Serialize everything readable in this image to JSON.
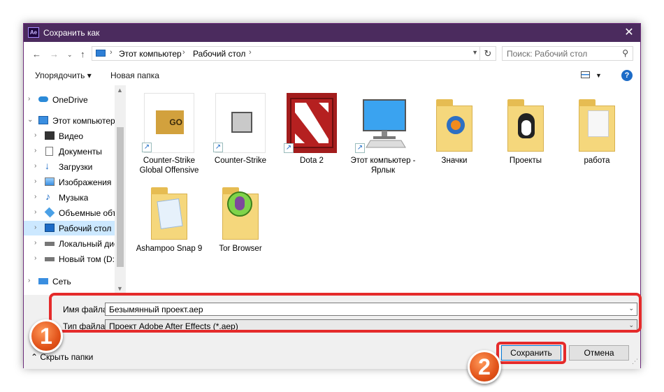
{
  "window": {
    "title": "Сохранить как",
    "app_icon_text": "Ae"
  },
  "address": {
    "crumbs": [
      "Этот компьютер",
      "Рабочий стол"
    ],
    "search_placeholder": "Поиск: Рабочий стол"
  },
  "toolbar": {
    "organize": "Упорядочить ▾",
    "new_folder": "Новая папка"
  },
  "sidebar": {
    "items": [
      {
        "label": "OneDrive",
        "icon": "cloud-icon"
      },
      {
        "label": "Этот компьютер",
        "icon": "computer-icon"
      },
      {
        "label": "Видео",
        "icon": "video-icon"
      },
      {
        "label": "Документы",
        "icon": "documents-icon"
      },
      {
        "label": "Загрузки",
        "icon": "downloads-icon"
      },
      {
        "label": "Изображения",
        "icon": "pictures-icon"
      },
      {
        "label": "Музыка",
        "icon": "music-icon"
      },
      {
        "label": "Объемные объ",
        "icon": "3d-objects-icon"
      },
      {
        "label": "Рабочий стол",
        "icon": "desktop-icon"
      },
      {
        "label": "Локальный дис",
        "icon": "drive-icon"
      },
      {
        "label": "Новый том (D:)",
        "icon": "drive-icon"
      },
      {
        "label": "Сеть",
        "icon": "network-icon"
      }
    ]
  },
  "files": [
    {
      "name": "Counter-Strike Global Offensive",
      "kind": "shortcut",
      "thumb_text": "GO"
    },
    {
      "name": "Counter-Strike",
      "kind": "shortcut",
      "thumb_text": ""
    },
    {
      "name": "Dota 2",
      "kind": "shortcut",
      "thumb_text": ""
    },
    {
      "name": "Этот компьютер - Ярлык",
      "kind": "shortcut",
      "thumb_text": ""
    },
    {
      "name": "Значки",
      "kind": "folder",
      "thumb_text": ""
    },
    {
      "name": "Проекты",
      "kind": "folder",
      "thumb_text": ""
    },
    {
      "name": "работа",
      "kind": "folder",
      "thumb_text": ""
    },
    {
      "name": "Ashampoo Snap 9",
      "kind": "folder",
      "thumb_text": ""
    },
    {
      "name": "Tor Browser",
      "kind": "folder",
      "thumb_text": ""
    }
  ],
  "form": {
    "filename_label": "Имя файла:",
    "filename_value": "Безымянный проект.aep",
    "filetype_label": "Тип файла:",
    "filetype_value": "Проект Adobe After Effects (*.aep)"
  },
  "buttons": {
    "hide_folders": "Скрыть папки",
    "save": "Сохранить",
    "cancel": "Отмена"
  },
  "annotations": {
    "step1": "1",
    "step2": "2"
  },
  "colors": {
    "titlebar": "#4b2b5e",
    "highlight": "#e52b2b",
    "selection": "#cce8ff"
  }
}
